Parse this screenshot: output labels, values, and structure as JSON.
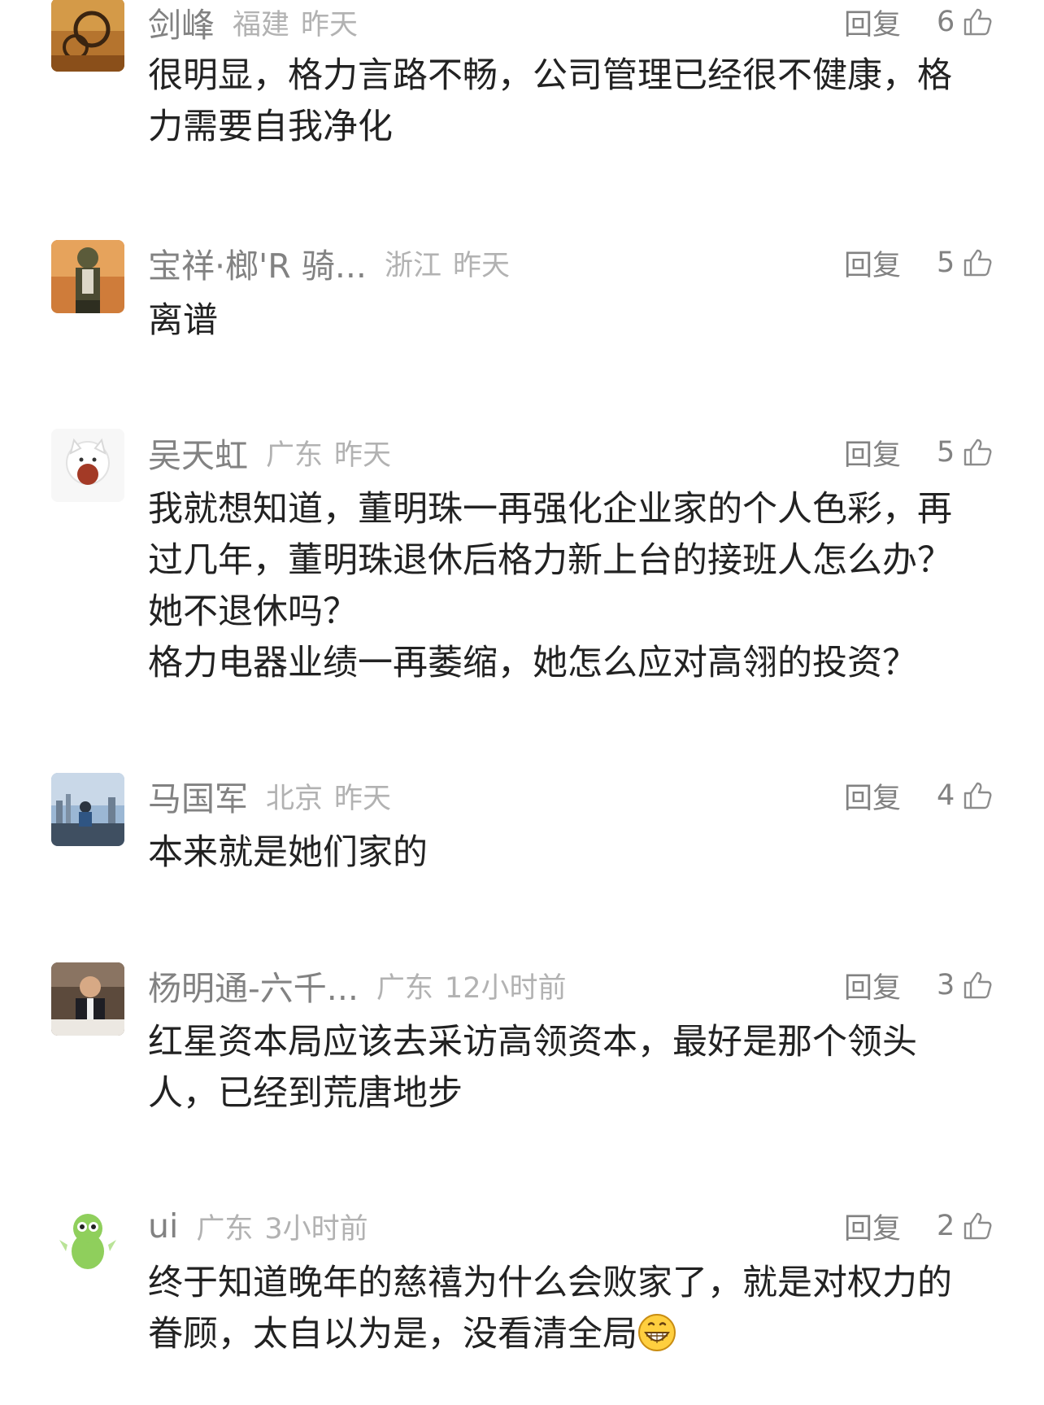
{
  "reply_label": "回复",
  "comments": [
    {
      "username": "剑峰",
      "region": "福建",
      "time": "昨天",
      "likes": "6",
      "text": "很明显，格力言路不畅，公司管理已经很不健康，格\n力需要自我净化",
      "avatar_icon": "photo-avatar"
    },
    {
      "username": "宝祥·榔'R 骑...",
      "region": "浙江",
      "time": "昨天",
      "likes": "5",
      "text": "离谱",
      "avatar_icon": "game-character-avatar"
    },
    {
      "username": "吴天虹",
      "region": "广东",
      "time": "昨天",
      "likes": "5",
      "text": "我就想知道，董明珠一再强化企业家的个人色彩，再\n过几年，董明珠退休后格力新上台的接班人怎么办？\n她不退休吗？\n格力电器业绩一再萎缩，她怎么应对高翎的投资？",
      "avatar_icon": "lucky-cat-avatar"
    },
    {
      "username": "马国军",
      "region": "北京",
      "time": "昨天",
      "likes": "4",
      "text": "本来就是她们家的",
      "avatar_icon": "city-skyline-avatar"
    },
    {
      "username": "杨明通-六千...",
      "region": "广东",
      "time": "12小时前",
      "likes": "3",
      "text": "红星资本局应该去采访高领资本，最好是那个领头\n人，已经到荒唐地步",
      "avatar_icon": "person-photo-avatar"
    },
    {
      "username": "ui",
      "region": "广东",
      "time": "3小时前",
      "likes": "2",
      "text": "终于知道晚年的慈禧为什么会败家了，就是对权力的\n眷顾，太自以为是，没看清全局",
      "avatar_icon": "green-dragon-avatar",
      "trailing_emoji": "grinning-face-emoji"
    }
  ]
}
